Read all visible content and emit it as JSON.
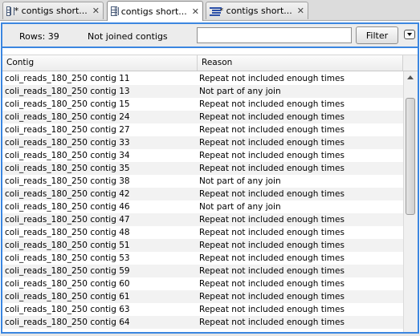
{
  "tabs": [
    {
      "label": "* contigs short...",
      "icon": "table-icon",
      "active": false
    },
    {
      "label": "contigs short...",
      "icon": "table-icon",
      "active": true
    },
    {
      "label": "* contigs short...",
      "icon": "text-list-icon",
      "active": false
    }
  ],
  "close_glyph": "✕",
  "toolbar": {
    "rows_label": "Rows: 39",
    "status_label": "Not joined contigs",
    "filter_value": "",
    "filter_button": "Filter"
  },
  "table": {
    "columns": [
      "Contig",
      "Reason"
    ],
    "rows": [
      [
        "coli_reads_180_250 contig 11",
        "Repeat not included enough times"
      ],
      [
        "coli_reads_180_250 contig 13",
        "Not part of any join"
      ],
      [
        "coli_reads_180_250 contig 15",
        "Repeat not included enough times"
      ],
      [
        "coli_reads_180_250 contig 24",
        "Repeat not included enough times"
      ],
      [
        "coli_reads_180_250 contig 27",
        "Repeat not included enough times"
      ],
      [
        "coli_reads_180_250 contig 33",
        "Repeat not included enough times"
      ],
      [
        "coli_reads_180_250 contig 34",
        "Repeat not included enough times"
      ],
      [
        "coli_reads_180_250 contig 35",
        "Repeat not included enough times"
      ],
      [
        "coli_reads_180_250 contig 38",
        "Not part of any join"
      ],
      [
        "coli_reads_180_250 contig 42",
        "Repeat not included enough times"
      ],
      [
        "coli_reads_180_250 contig 46",
        "Not part of any join"
      ],
      [
        "coli_reads_180_250 contig 47",
        "Repeat not included enough times"
      ],
      [
        "coli_reads_180_250 contig 48",
        "Repeat not included enough times"
      ],
      [
        "coli_reads_180_250 contig 51",
        "Repeat not included enough times"
      ],
      [
        "coli_reads_180_250 contig 53",
        "Repeat not included enough times"
      ],
      [
        "coli_reads_180_250 contig 59",
        "Repeat not included enough times"
      ],
      [
        "coli_reads_180_250 contig 60",
        "Repeat not included enough times"
      ],
      [
        "coli_reads_180_250 contig 61",
        "Repeat not included enough times"
      ],
      [
        "coli_reads_180_250 contig 63",
        "Repeat not included enough times"
      ],
      [
        "coli_reads_180_250 contig 64",
        "Repeat not included enough times"
      ]
    ]
  },
  "colors": {
    "accent": "#3b86e0",
    "row_alt": "#f2f2f2"
  }
}
